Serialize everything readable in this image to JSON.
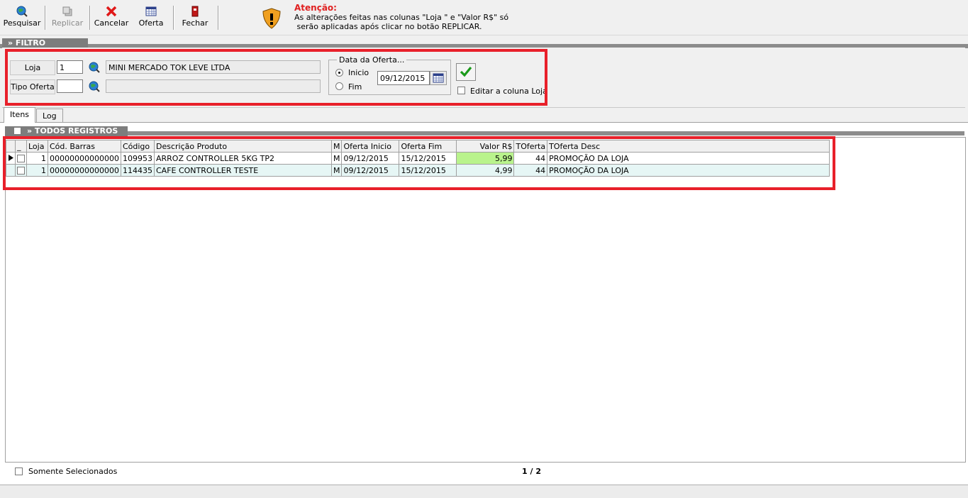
{
  "toolbar": {
    "buttons": [
      {
        "label": "Pesquisar",
        "icon": "search-globe-icon"
      },
      {
        "label": "Replicar",
        "icon": "replicate-icon",
        "disabled": true
      },
      {
        "label": "Cancelar",
        "icon": "cancel-x-icon"
      },
      {
        "label": "Oferta",
        "icon": "calendar-grid-icon"
      },
      {
        "label": "Fechar",
        "icon": "exit-door-icon"
      }
    ],
    "warning": {
      "title": "Atenção:",
      "line1": "As alterações feitas nas colunas \"Loja \" e \"Valor R$\" só",
      "line2": " serão aplicadas após clicar no botão REPLICAR."
    }
  },
  "filter": {
    "section_title": "» FILTRO",
    "loja_label": "Loja",
    "loja_value": "1",
    "loja_name": "MINI MERCADO TOK LEVE LTDA",
    "tipo_oferta_label": "Tipo Oferta",
    "tipo_oferta_value": "",
    "tipo_oferta_desc": "",
    "date_group_title": "Data da Oferta...",
    "radio_inicio": "Inicio",
    "radio_fim": "Fim",
    "date_value": "09/12/2015",
    "editar_loja_label": "Editar a coluna Loja"
  },
  "tabs": [
    {
      "label": "Itens",
      "active": true
    },
    {
      "label": "Log",
      "active": false
    }
  ],
  "grid": {
    "section_title": "» TODOS REGISTROS",
    "columns": [
      "_",
      "Loja",
      "Cód. Barras",
      "Código",
      "Descrição Produto",
      "M",
      "Oferta Inicio",
      "Oferta Fim",
      "Valor R$",
      "TOferta",
      "TOferta Desc"
    ],
    "rows": [
      [
        "",
        "1",
        "00000000000000",
        "109953",
        "ARROZ CONTROLLER 5KG TP2",
        "M",
        "09/12/2015",
        "15/12/2015",
        "5,99",
        "44",
        "PROMOÇÃO DA LOJA"
      ],
      [
        "",
        "1",
        "00000000000000",
        "114435",
        "CAFE CONTROLLER TESTE",
        "M",
        "09/12/2015",
        "15/12/2015",
        "4,99",
        "44",
        "PROMOÇÃO DA LOJA"
      ]
    ]
  },
  "bottom": {
    "somente_label": "Somente Selecionados",
    "page_indicator": "1 / 2"
  },
  "colors": {
    "highlight_red": "#e8202a",
    "value_green": "#b9f38c",
    "alt_row": "#e6f6f5"
  }
}
